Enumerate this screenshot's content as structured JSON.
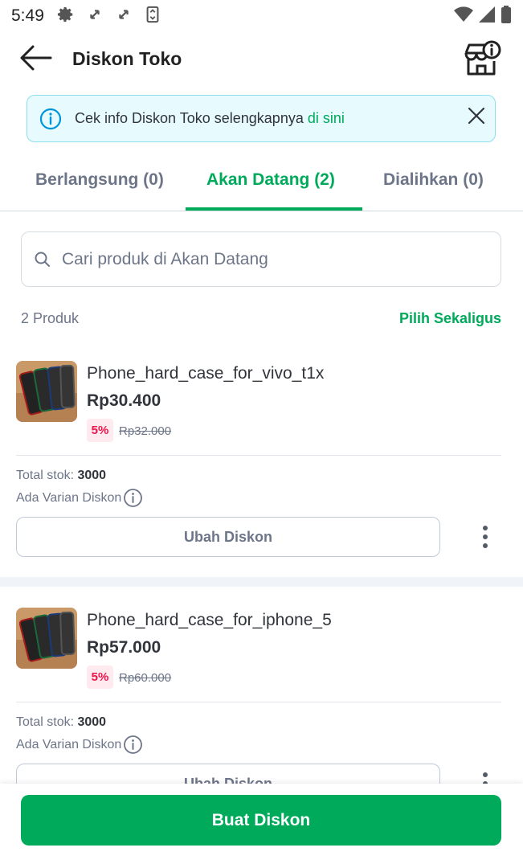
{
  "status_bar": {
    "time": "5:49",
    "icons": [
      "gear-icon",
      "sync-icon",
      "sync-icon",
      "screenshot-icon",
      "wifi-icon",
      "signal-icon",
      "battery-icon"
    ]
  },
  "header": {
    "title": "Diskon Toko",
    "back_icon": "arrow-left-icon",
    "shop_info_icon": "shop-info-icon"
  },
  "info_banner": {
    "text": "Cek info Diskon Toko selengkapnya",
    "link": "di sini",
    "icon": "info-icon",
    "close_icon": "close-icon"
  },
  "tabs": [
    {
      "label": "Berlangsung (0)",
      "active": false
    },
    {
      "label": "Akan Datang (2)",
      "active": true
    },
    {
      "label": "Dialihkan (0)",
      "active": false
    }
  ],
  "search": {
    "placeholder": "Cari produk di Akan Datang",
    "value": ""
  },
  "list_meta": {
    "count": "2 Produk",
    "select_all": "Pilih Sekaligus"
  },
  "products": [
    {
      "name": "Phone_hard_case_for_vivo_t1x",
      "price": "Rp30.400",
      "discount": "5%",
      "original_price": "Rp32.000",
      "stock_label": "Total stok:",
      "stock_value": "3000",
      "variant_label": "Ada Varian Diskon",
      "edit_label": "Ubah Diskon"
    },
    {
      "name": "Phone_hard_case_for_iphone_5",
      "price": "Rp57.000",
      "discount": "5%",
      "original_price": "Rp60.000",
      "stock_label": "Total stok:",
      "stock_value": "3000",
      "variant_label": "Ada Varian Diskon",
      "edit_label": "Ubah Diskon"
    }
  ],
  "bottom": {
    "create_label": "Buat Diskon"
  },
  "colors": {
    "primary": "#00aa5b",
    "discount_red": "#ef144a",
    "banner_bg": "#e7fafd",
    "banner_border": "#8be0ed",
    "text_main": "#31353b",
    "text_muted": "#6d7588"
  }
}
